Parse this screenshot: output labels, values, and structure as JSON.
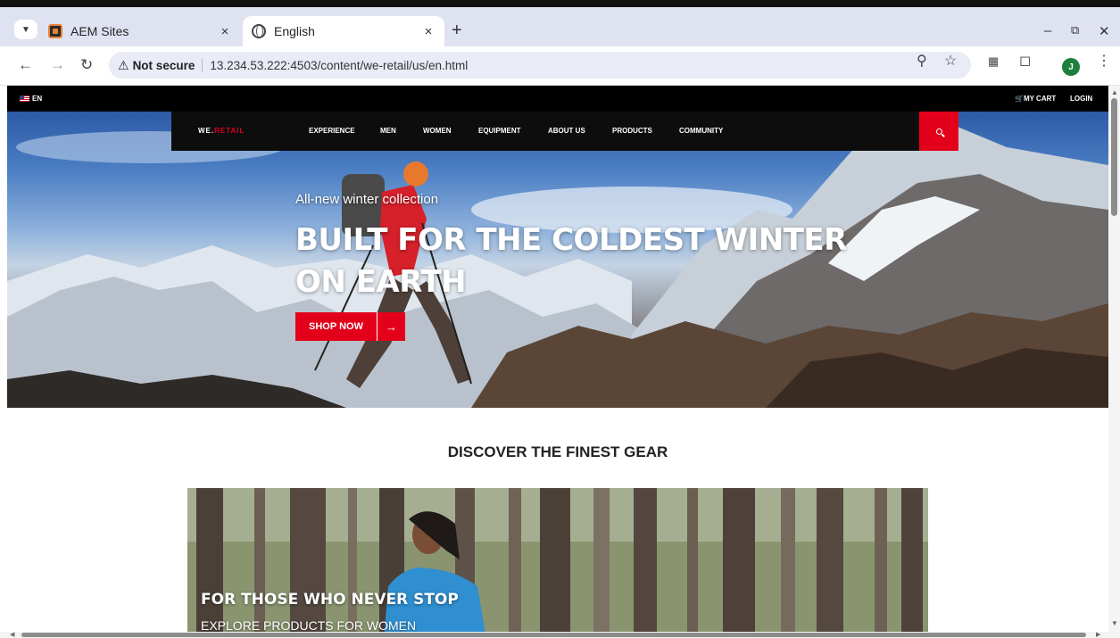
{
  "browser": {
    "tabs": [
      {
        "title": "AEM Sites",
        "icon": "aem-icon",
        "active": false
      },
      {
        "title": "English",
        "icon": "globe-icon",
        "active": true
      }
    ],
    "new_tab": "+",
    "window_controls": {
      "minimize": "–",
      "restore": "⧉",
      "close": "✕"
    },
    "tab_close": "×",
    "security_label": "Not secure",
    "url": "13.234.53.222:4503/content/we-retail/us/en.html",
    "profile_initial": "J"
  },
  "site": {
    "topbar": {
      "language": "EN",
      "cart": "MY CART",
      "login": "LOGIN"
    },
    "brand": {
      "prefix": "WE.",
      "suffix": "RETAIL"
    },
    "nav": [
      "EXPERIENCE",
      "MEN",
      "WOMEN",
      "EQUIPMENT",
      "ABOUT US",
      "PRODUCTS",
      "COMMUNITY"
    ],
    "hero": {
      "subtitle": "All-new winter collection",
      "title": "BUILT FOR THE COLDEST WINTER ON EARTH",
      "cta": "SHOP NOW",
      "cta_arrow": "→"
    },
    "section_title": "DISCOVER THE FINEST GEAR",
    "promo": {
      "title": "FOR THOSE WHO NEVER STOP",
      "subtitle": "EXPLORE PRODUCTS FOR WOMEN"
    }
  },
  "colors": {
    "accent": "#e3001b",
    "nav_bg": "#0d0d0d"
  }
}
